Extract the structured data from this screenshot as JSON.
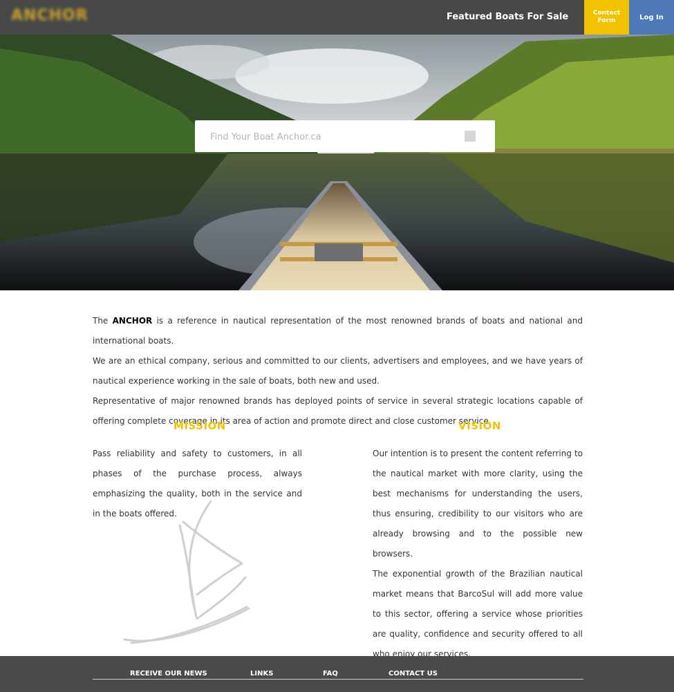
{
  "header": {
    "logo_text": "ANCHOR",
    "featured_link": "Featured Boats For Sale",
    "contact_button": "Contact Form",
    "login_button": "Log In"
  },
  "hero": {
    "search_placeholder": "Find Your Boat Anchor.ca"
  },
  "intro": {
    "brand": "ANCHOR",
    "line1_prefix": "The",
    "line1_suffix": "is a reference in nautical representation of the most renowned brands of boats and national and international boats.",
    "paragraph2": "We are an ethical company, serious and committed to our clients, advertisers and employees, and we have years of nautical experience working in the sale of boats, both new and used.",
    "paragraph3": "Representative of major renowned brands has deployed points of service in several strategic locations capable of offering complete coverage in its area of action and promote direct and close customer service."
  },
  "mission": {
    "title": "MISSION",
    "text": "Pass reliability and safety to customers, in all phases of the purchase process, always emphasizing the quality, both in the service and in the boats offered."
  },
  "vision": {
    "title": "VISION",
    "text1": "Our intention is to present the content referring to the nautical market with more clarity, using the best mechanisms for understanding the users, thus ensuring, credibility to our visitors who are already browsing and to the possible new browsers.",
    "text2": "The exponential growth of the Brazilian nautical market means that BarcoSul will add more value to this sector, offering a service whose priorities are quality, confidence and security offered to all who enjoy our services."
  },
  "footer": {
    "links": [
      "RECEIVE OUR NEWS",
      "LINKS",
      "FAQ",
      "CONTACT US"
    ]
  },
  "colors": {
    "header_bg": "#484848",
    "accent_yellow": "#f2c200",
    "login_blue": "#4e79b8",
    "footer_bg": "#4a4a4a"
  }
}
